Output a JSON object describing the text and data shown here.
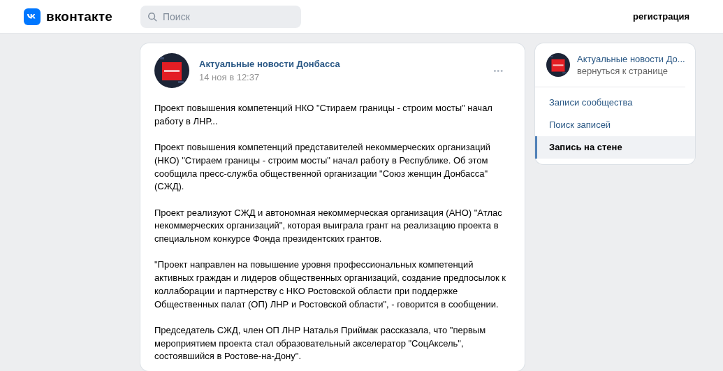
{
  "header": {
    "logo_text": "вконтакте",
    "search": {
      "placeholder": "Поиск"
    },
    "register_link": "регистрация"
  },
  "post": {
    "author": "Актуальные новости Донбасса",
    "date": "14 ноя в 12:37",
    "menu": "•••",
    "paragraphs": [
      "Проект повышения компетенций НКО \"Стираем границы - строим мосты\" начал работу в ЛНР...",
      "Проект повышения компетенций представителей некоммерческих организаций (НКО) \"Стираем границы - строим мосты\" начал работу в Республике. Об этом сообщила пресс-служба общественной организации \"Союз женщин Донбасса\" (СЖД).",
      "Проект реализуют СЖД и автономная некоммерческая организация (АНО) \"Атлас некоммерческих организаций\", которая выиграла грант на реализацию проекта в специальном конкурсе Фонда президентских грантов.",
      "\"Проект направлен на повышение уровня профессиональных компетенций активных граждан и лидеров общественных организаций, создание предпосылок к коллаборации и партнерству с НКО Ростовской области при поддержке Общественных палат (ОП) ЛНР и Ростовской области\", - говорится в сообщении.",
      "Председатель СЖД, член ОП ЛНР Наталья Приймак рассказала, что \"первым мероприятием проекта стал образовательный акселератор \"СоцАксель\", состоявшийся в Ростове-на-Дону\"."
    ]
  },
  "sidebar": {
    "group_name": "Актуальные новости До...",
    "back_link": "вернуться к странице",
    "items": [
      {
        "label": "Записи сообщества",
        "selected": false
      },
      {
        "label": "Поиск записей",
        "selected": false
      },
      {
        "label": "Запись на стене",
        "selected": true
      }
    ]
  }
}
